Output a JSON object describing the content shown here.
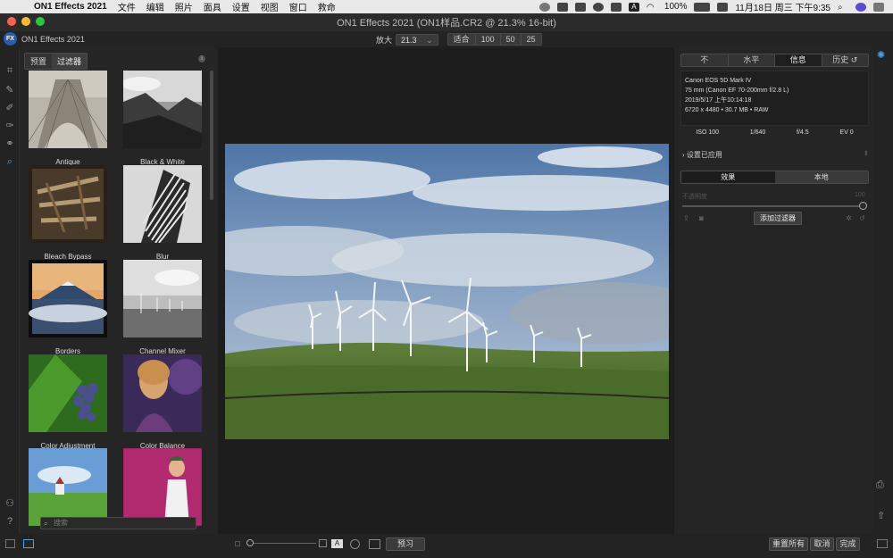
{
  "menubar": {
    "app": "ON1 Effects 2021",
    "items": [
      "文件",
      "编辑",
      "照片",
      "面具",
      "设置",
      "视图",
      "窗口",
      "救命"
    ],
    "battery": "100%",
    "clock": "11月18日 周三 下午9:35",
    "input_indicator": "A"
  },
  "window": {
    "title": "ON1 Effects 2021 (ON1样品.CR2 @ 21.3% 16-bit)"
  },
  "toolbar": {
    "logo": "FX",
    "app_name": "ON1 Effects 2021",
    "zoom_label": "放大",
    "zoom_value": "21.3",
    "zoom_caret": "⌄",
    "fit_label": "适合",
    "presets": [
      "100",
      "50",
      "25"
    ]
  },
  "browser": {
    "tabs": [
      "预置",
      "过滤器"
    ],
    "info": "i",
    "search_placeholder": "搜索",
    "filters": [
      {
        "label": "Antique"
      },
      {
        "label": "Black & White"
      },
      {
        "label": "Bleach Bypass"
      },
      {
        "label": "Blur"
      },
      {
        "label": "Borders"
      },
      {
        "label": "Channel Mixer"
      },
      {
        "label": "Color Adjustment"
      },
      {
        "label": "Color Balance"
      },
      {
        "label": ""
      },
      {
        "label": ""
      }
    ]
  },
  "right_panel": {
    "tabs": [
      "不",
      "水平",
      "信息",
      "历史 ↺"
    ],
    "camera": "Canon EOS 5D Mark IV",
    "lens": "75 mm (Canon EF 70-200mm f/2.8 L)",
    "datetime": "2019/5/17  上午10:14:18",
    "dimensions": "6720 x 4480 • 30.7 MB • RAW",
    "exif": [
      "ISO 100",
      "1/640",
      "f/4.5",
      "EV 0"
    ],
    "applied_label": "设置已应用",
    "applied_arrow": "⇕",
    "fx_tabs": [
      "效果",
      "本地"
    ],
    "opacity_label": "不透明度",
    "opacity_value": "100",
    "opacity_level": 1.0,
    "add_filter": "添加过滤器"
  },
  "bottom": {
    "preview": "预习",
    "reset_all": "重置所有",
    "cancel": "取消",
    "done": "完成",
    "view_toggle_a": "A"
  }
}
